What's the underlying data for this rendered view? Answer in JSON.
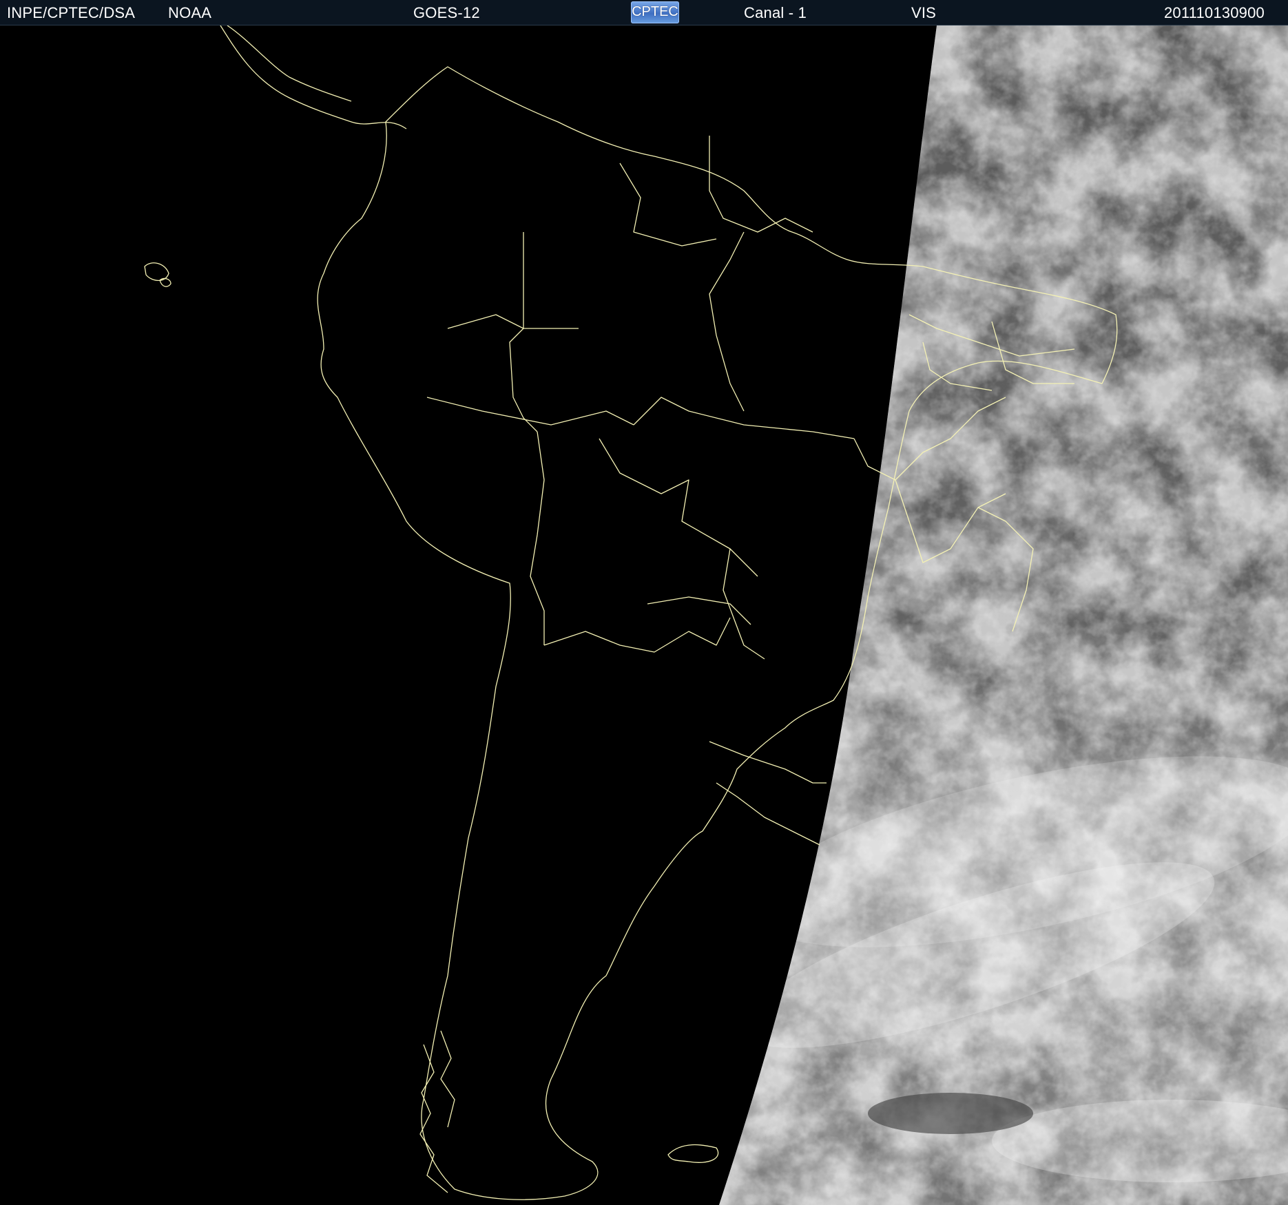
{
  "header": {
    "org": "INPE/CPTEC/DSA",
    "agency": "NOAA",
    "satellite": "GOES-12",
    "logo_text": "CPTEC",
    "channel": "Canal - 1",
    "band": "VIS",
    "timestamp": "201110130900"
  },
  "map": {
    "region": "South America",
    "night_side": "west",
    "day_side": "east",
    "colors": {
      "header_bg": "#0b1520",
      "header_text": "#ffffff",
      "night": "#000000",
      "day_cloud": "#8c8c8c",
      "borders": "#f4f1b4"
    }
  }
}
